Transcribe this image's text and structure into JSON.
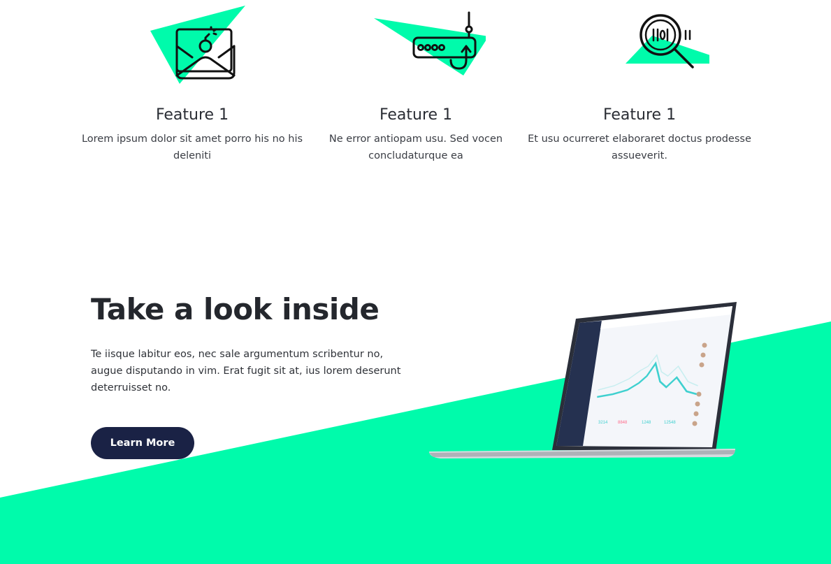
{
  "colors": {
    "accent": "#00fbab",
    "button_bg": "#1a2245",
    "laptop_accent": "#3fd0cf"
  },
  "features": [
    {
      "icon": "mail-bomb-icon",
      "title": "Feature 1",
      "description": "Lorem ipsum dolor sit amet porro his no his deleniti"
    },
    {
      "icon": "router-icon",
      "title": "Feature 1",
      "description": "Ne error antiopam usu. Sed vocen concludaturque ea"
    },
    {
      "icon": "magnifier-code-icon",
      "title": "Feature 1",
      "description": "Et usu ocurreret elaboraret doctus prodesse assueverit."
    }
  ],
  "inside": {
    "heading": "Take a look inside",
    "paragraph": "Te iisque labitur eos, nec sale argumentum scribentur no, augue disputando in vim. Erat fugit sit at, ius lorem deserunt deterruisset no.",
    "button_label": "Learn More"
  },
  "laptop_icon": "laptop-dashboard-icon"
}
